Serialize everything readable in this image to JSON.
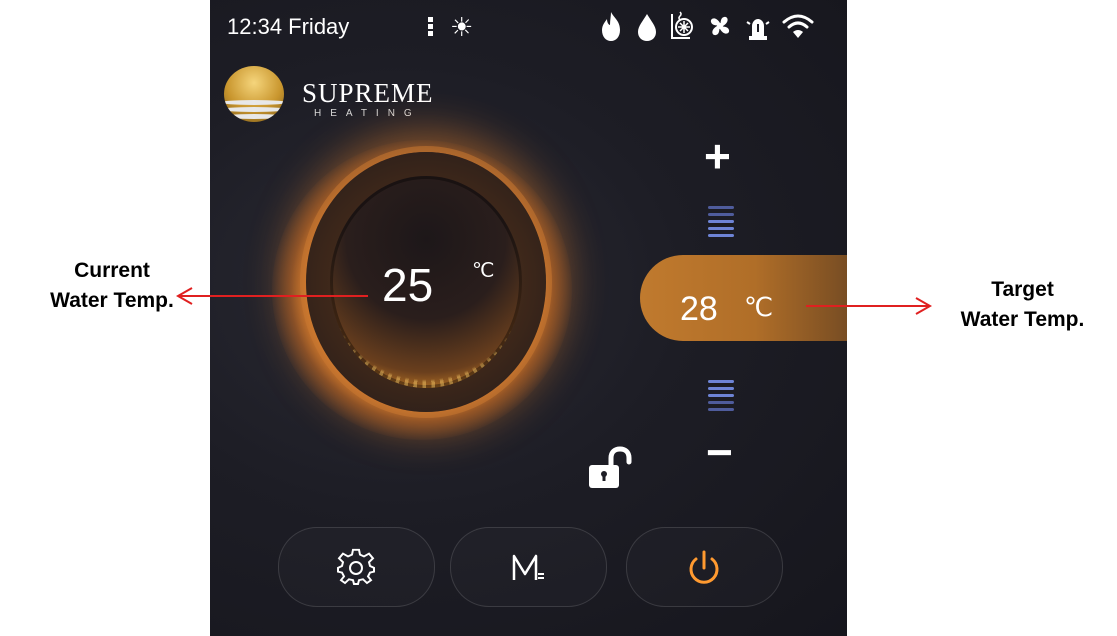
{
  "status_bar": {
    "time": "12:34 Friday",
    "icons": [
      "signal-bars-icon",
      "sun-icon",
      "flame-icon",
      "water-drop-icon",
      "coil-heater-icon",
      "fan-icon",
      "alarm-icon",
      "wifi-icon"
    ]
  },
  "brand": {
    "name": "SUPREME",
    "tagline": "HEATING"
  },
  "current_temp": {
    "value": "25",
    "unit": "℃"
  },
  "target_temp": {
    "value": "28",
    "unit": "℃"
  },
  "controls": {
    "increase": "+",
    "decrease": "−"
  },
  "bottom_bar": {
    "mode_label": "M",
    "buttons": [
      "settings",
      "mode",
      "power"
    ]
  },
  "annotations": {
    "left": "Current Water Temp.",
    "right": "Target Water Temp."
  },
  "colors": {
    "accent_orange": "#c07a2e",
    "glow": "#ff9a30",
    "scale_blue": "#5b6fc4",
    "background": "#1d1d25"
  }
}
